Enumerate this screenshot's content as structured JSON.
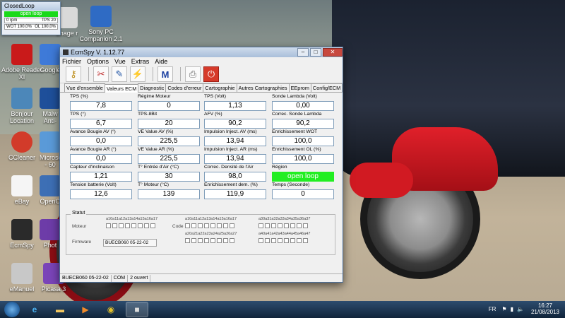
{
  "widget": {
    "title": "ClosedLoop",
    "mode": "open loop",
    "rpm": "0 rpm",
    "tps": "TPS 20",
    "wot": "WOT 100,0%",
    "ol": "OL 100,0%"
  },
  "desktop_icons": [
    {
      "label": "Image\nr",
      "icon": "image-icon"
    },
    {
      "label": "Sony PC Companion 2.1",
      "icon": "sony-pc-companion-icon"
    },
    {
      "label": "Adobe Reader XI",
      "icon": "adobe-reader-icon"
    },
    {
      "label": "Google",
      "icon": "google-icon"
    },
    {
      "label": "Bonjour Location",
      "icon": "computer-icon"
    },
    {
      "label": "Malw Anti-",
      "icon": "malwarebytes-icon"
    },
    {
      "label": "CCleaner",
      "icon": "ccleaner-icon"
    },
    {
      "label": "Microso - 60",
      "icon": "microsoft-icon"
    },
    {
      "label": "eBay",
      "icon": "ebay-icon"
    },
    {
      "label": "OpenO",
      "icon": "openoffice-icon"
    },
    {
      "label": "EcmSpy",
      "icon": "ecmspy-icon"
    },
    {
      "label": "Phot",
      "icon": "photo-icon"
    },
    {
      "label": "eManuel",
      "icon": "emanual-icon"
    },
    {
      "label": "Picasa 3",
      "icon": "picasa-icon"
    }
  ],
  "window": {
    "title": "EcmSpy V. 1.12.77",
    "menu": [
      "Fichier",
      "Options",
      "Vue",
      "Extras",
      "Aide"
    ],
    "tabs": [
      "Vue d'ensemble",
      "Valeurs ECM",
      "Diagnostic",
      "Codes d'erreur",
      "Cartographie",
      "Autres Cartographies",
      "EEprom",
      "Config/ECM"
    ],
    "active_tab": "Valeurs ECM"
  },
  "fields": [
    {
      "label": "TPS (%)",
      "value": "7,8"
    },
    {
      "label": "Régime Moteur",
      "value": "0"
    },
    {
      "label": "TPS (Volt)",
      "value": "1,13"
    },
    {
      "label": "Sonde Lambda (Volt)",
      "value": "0,00"
    },
    {
      "label": "TPS (°)",
      "value": "6,7"
    },
    {
      "label": "TPS-8Bit",
      "value": "20"
    },
    {
      "label": "AFV (%)",
      "value": "90,2"
    },
    {
      "label": "Correc. Sonde Lambda",
      "value": "90,2"
    },
    {
      "label": "Avance Bougie AV (°)",
      "value": "0,0"
    },
    {
      "label": "VE Value AV (%)",
      "value": "225,5"
    },
    {
      "label": "Impulsion Inject. AV (ms)",
      "value": "13,94"
    },
    {
      "label": "Enrichissement WOT",
      "value": "100,0"
    },
    {
      "label": "Avance Bougie AR (°)",
      "value": "0,0"
    },
    {
      "label": "VE Value AR (%)",
      "value": "225,5"
    },
    {
      "label": "Impulsion Inject. AR (ms)",
      "value": "13,94"
    },
    {
      "label": "Enrichissement OL (%)",
      "value": "100,0"
    },
    {
      "label": "Capteur d'inclinaison",
      "value": "1,21"
    },
    {
      "label": "T° Entrée d'Air (°C)",
      "value": "30"
    },
    {
      "label": "Correc. Densité de l'Air",
      "value": "98,0"
    },
    {
      "label": "Région",
      "value": "open loop"
    },
    {
      "label": "Tension batterie (Volt)",
      "value": "12,6"
    },
    {
      "label": "T° Moteur (°C)",
      "value": "139"
    },
    {
      "label": "Enrichissement dem. (%)",
      "value": "119,9"
    },
    {
      "label": "Temps (Seconde)",
      "value": "0"
    }
  ],
  "region_color": "#22ee22",
  "status": {
    "caption": "Statut",
    "moteur_label": "Moteur",
    "code_label": "Code",
    "firmware_label": "Firmware",
    "firmware_value": "BUECB060 05-22-02",
    "bits1": "a10a11a12a13a14a15a16a17",
    "bits2": "a10a11a12a13a14a15a16a17",
    "bits3": "a30a31a32a33a34a35a36a37",
    "bits4": "a20a21a22a23a24a25a26a27",
    "bits5": "a40a41a42a43a44a45a46a47"
  },
  "statusbar": {
    "firmware": "BUECB060 05-22-02",
    "port": "COM",
    "state": "2 ouvert"
  },
  "taskbar": {
    "lang": "FR",
    "time": "16:27",
    "date": "21/08/2013"
  }
}
